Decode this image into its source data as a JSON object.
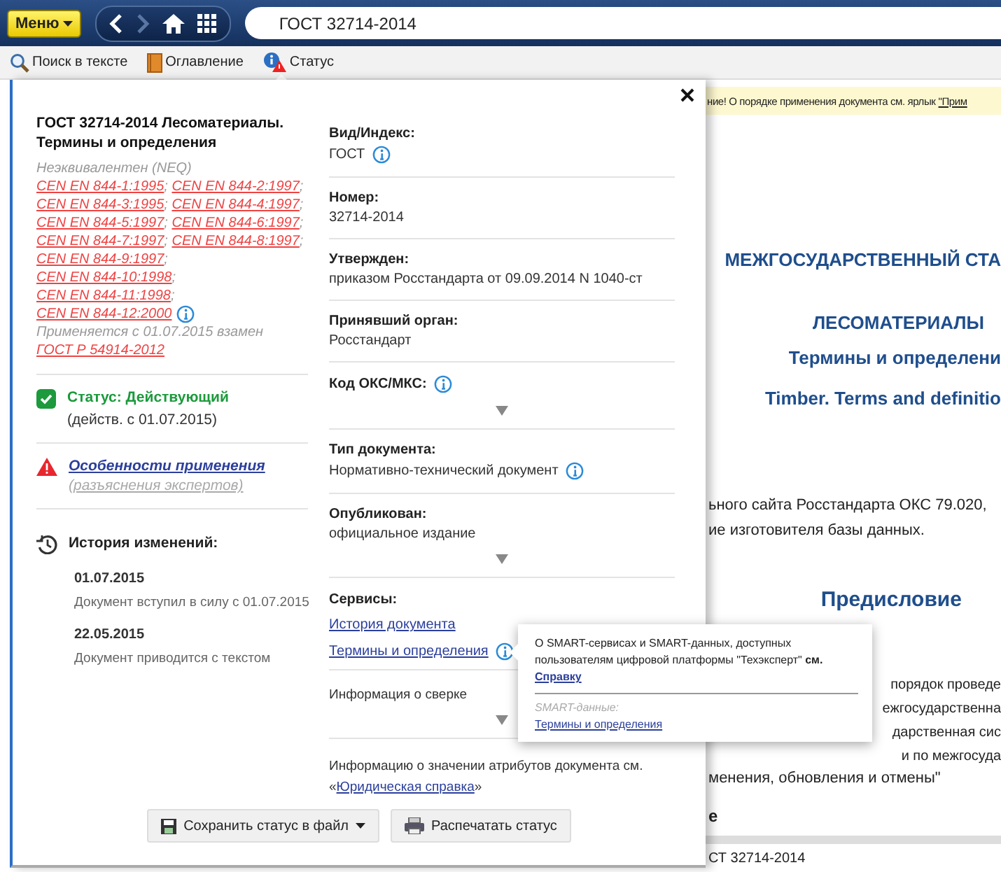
{
  "top_bar": {
    "menu_button": "Меню",
    "search_field": {
      "value": "ГОСТ 32714-2014"
    }
  },
  "toolbar": {
    "tabs": [
      {
        "label": "Поиск в тексте",
        "kind": "search",
        "selected": false
      },
      {
        "label": "Оглавление",
        "kind": "contents",
        "selected": false
      },
      {
        "label": "Статус",
        "kind": "status",
        "selected": true
      }
    ]
  },
  "status_panel": {
    "title": "ГОСТ 32714-2014 Лесоматериалы. Термины и определения",
    "equivalence": {
      "prefix": "Неэквивалентен (NEQ)",
      "separator": ";",
      "links": [
        "CEN EN 844-1:1995",
        "CEN EN 844-2:1997",
        "CEN EN 844-3:1995",
        "CEN EN 844-4:1997",
        "CEN EN 844-5:1997",
        "CEN EN 844-6:1997",
        "CEN EN 844-7:1997",
        "CEN EN 844-8:1997",
        "CEN EN 844-9:1997",
        "CEN EN 844-10:1998",
        "CEN EN 844-11:1998",
        "CEN EN 844-12:2000"
      ],
      "info": true
    },
    "applied": {
      "text": "Применяется с 01.07.2015 взамен",
      "link": "ГОСТ Р 54914-2012"
    },
    "status": {
      "label": "Статус: Действующий",
      "since": "(действ. с 01.07.2015)"
    },
    "features": {
      "link": "Особенности применения",
      "note": "(разъяснения экспертов)"
    },
    "history": {
      "title": "История изменений:",
      "entries": [
        {
          "date": "01.07.2015",
          "text": "Документ вступил в силу с 01.07.2015"
        },
        {
          "date": "22.05.2015",
          "text": "Документ приводится с текстом"
        }
      ]
    },
    "attributes": [
      {
        "label": "Вид/Индекс:",
        "value": "ГОСТ",
        "info": true
      },
      {
        "label": "Номер:",
        "value": "32714-2014",
        "info": false
      },
      {
        "label": "Утвержден:",
        "value": "приказом Росстандарта от 09.09.2014 N 1040-ст",
        "info": false
      },
      {
        "label": "Принявший орган:",
        "value": "Росстандарт",
        "info": false
      },
      {
        "label": "Код ОКС/МКС:",
        "info": true,
        "expanded": false
      },
      {
        "label": "Тип документа:",
        "value": "Нормативно-технический документ",
        "info": true
      },
      {
        "label": "Опубликован:",
        "value": "официальное издание",
        "info": false,
        "expanded": false
      }
    ],
    "services": {
      "title": "Сервисы:",
      "links": [
        {
          "label": "История документа",
          "info": false
        },
        {
          "label": "Термины и определения",
          "info": true
        }
      ]
    },
    "reconciliation": {
      "label": "Информация о сверке",
      "expanded": false
    },
    "legal_note": {
      "text": "Информацию о значении атрибутов документа см.",
      "quote_open": "«",
      "link": "Юридическая справка",
      "quote_close": "»"
    },
    "buttons": [
      {
        "label": "Сохранить статус в файл",
        "kind": "save",
        "dropdown": true
      },
      {
        "label": "Распечатать статус",
        "kind": "print",
        "dropdown": false
      }
    ]
  },
  "tooltip": {
    "text": "О SMART-сервисах и SMART-данных, доступных пользователям цифровой платформы \"Техэксперт\" **см.**",
    "link": "Справку",
    "section": "SMART-данные:",
    "section_link": "Термины и определения"
  },
  "document": {
    "banner": {
      "text": "ние! О порядке применения документа см. ярлык",
      "link": "\"Прим"
    },
    "headings": [
      "МЕЖГОСУДАРСТВЕННЫЙ СТА",
      "ЛЕСОМАТЕРИАЛЫ",
      "Термины и определени",
      "Timber. Terms and definitio"
    ],
    "intro_lines": [
      "ьного сайта Росстандарта ОКС 79.020,",
      "ие изготовителя базы данных."
    ],
    "section_title": "Предисловие",
    "body_lines": [
      "порядок проведе",
      "ежгосударственна",
      "дарственная сис",
      "и по межгосуда"
    ],
    "body_tail": "менения, обновления и отмены\"",
    "cut_heading": "е",
    "footer": "СТ 32714-2014"
  }
}
